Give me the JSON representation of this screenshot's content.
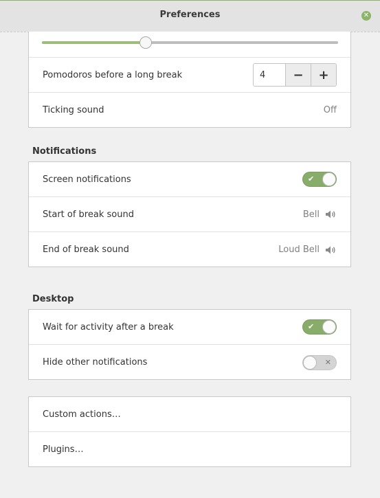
{
  "window": {
    "title": "Preferences",
    "close_icon": "close-icon"
  },
  "timer": {
    "slider_value_fraction": 0.35,
    "pomodoros_label": "Pomodoros before a long break",
    "pomodoros_value": "4",
    "decrement_symbol": "−",
    "increment_symbol": "+",
    "ticking_label": "Ticking sound",
    "ticking_value": "Off"
  },
  "notifications": {
    "heading": "Notifications",
    "screen_label": "Screen notifications",
    "screen_on": true,
    "start_break_label": "Start of break sound",
    "start_break_value": "Bell",
    "end_break_label": "End of break sound",
    "end_break_value": "Loud Bell"
  },
  "desktop": {
    "heading": "Desktop",
    "wait_label": "Wait for activity after a break",
    "wait_on": true,
    "hide_label": "Hide other notifications",
    "hide_on": false
  },
  "extras": {
    "custom_actions_label": "Custom actions…",
    "plugins_label": "Plugins…"
  },
  "colors": {
    "accent": "#88ad6a",
    "switch_off": "#d4d4d4"
  }
}
